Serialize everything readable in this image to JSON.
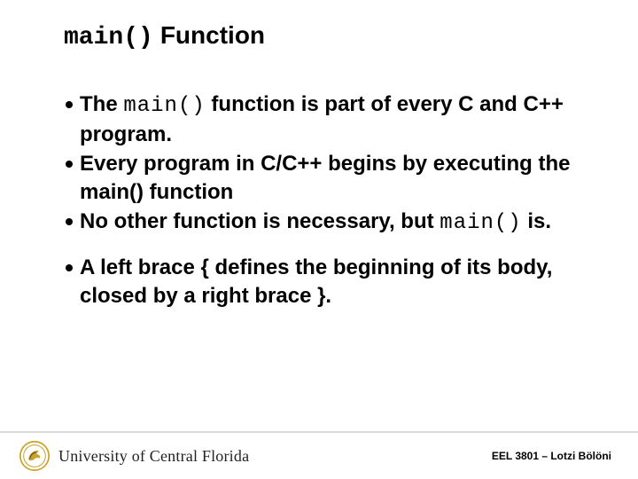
{
  "title": {
    "code": "main()",
    "text": "Function"
  },
  "bullets": {
    "b1": {
      "pre": "The ",
      "code": "main()",
      "post": " function is part of every C and C++ program."
    },
    "b2": {
      "text": "Every program in C/C++ begins by executing the main() function"
    },
    "b3": {
      "pre": "No other function is necessary, but ",
      "code": "main()",
      "post": " is."
    },
    "b4": {
      "text": "A left brace { defines the beginning of its body, closed by a right brace }."
    }
  },
  "footer": {
    "university": "University of Central Florida",
    "course": "EEL 3801 – Lotzi Bölöni"
  },
  "colors": {
    "ucf_gold": "#C9A227",
    "ucf_dark": "#231F20"
  }
}
